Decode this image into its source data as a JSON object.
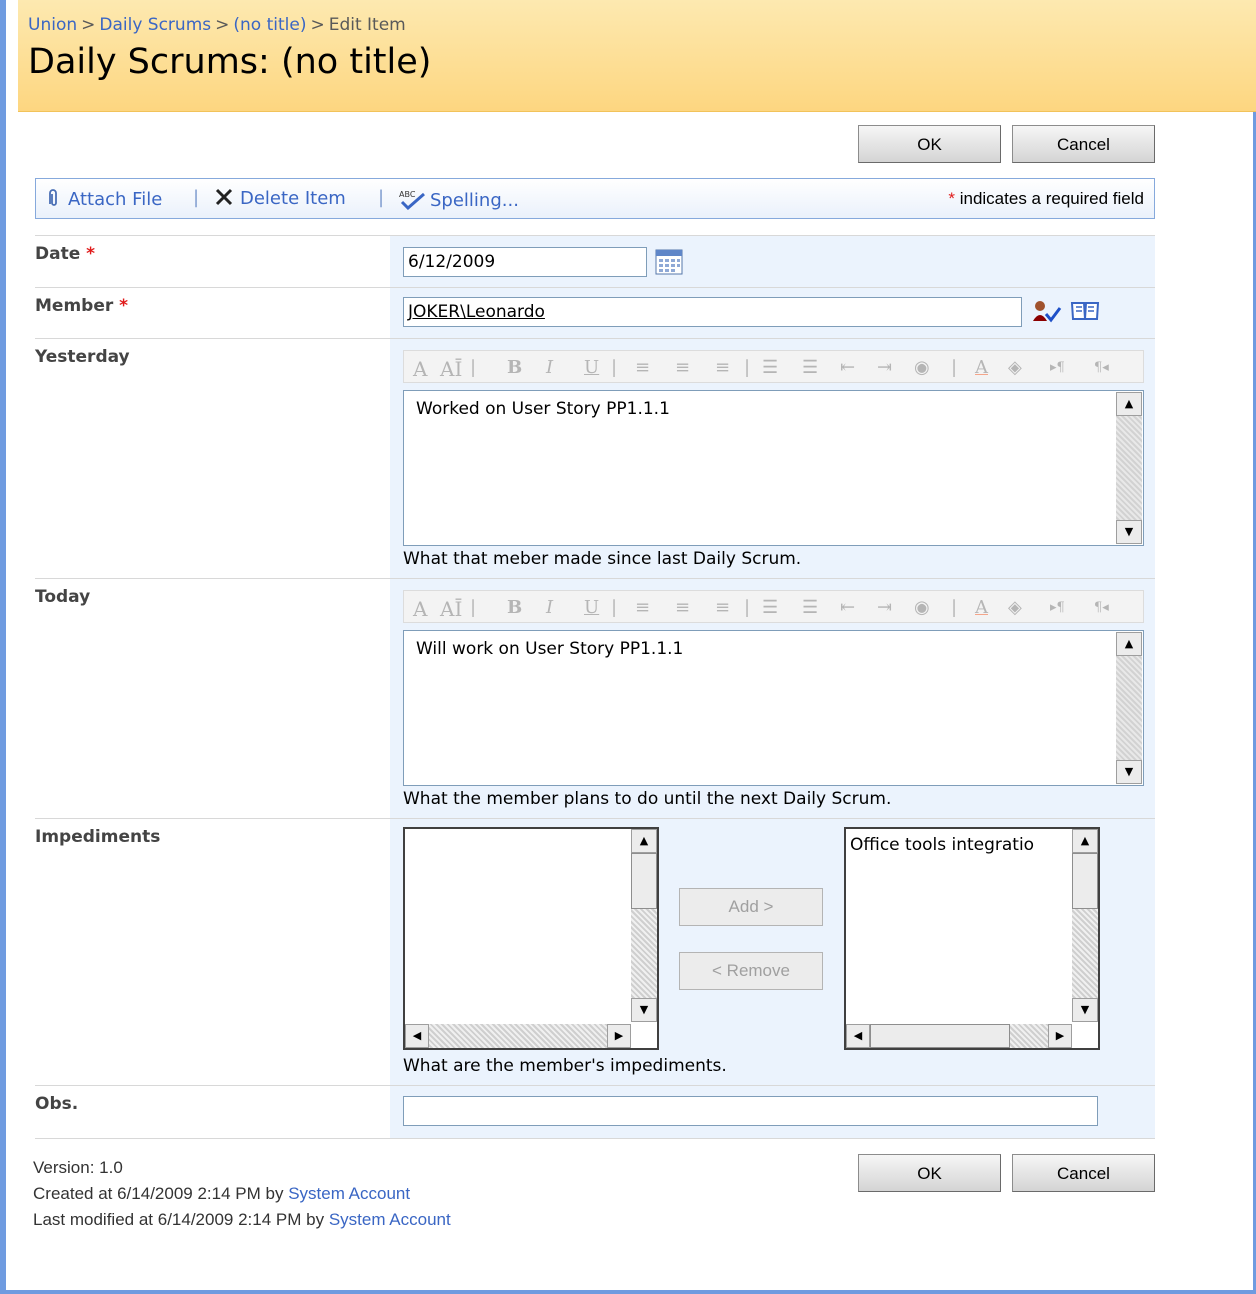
{
  "breadcrumb": {
    "items": [
      "Union",
      "Daily Scrums",
      "(no title)"
    ],
    "current": "Edit Item",
    "separator": ">"
  },
  "page_title": "Daily Scrums: (no title)",
  "buttons": {
    "ok": "OK",
    "cancel": "Cancel"
  },
  "toolbar": {
    "attach": "Attach File",
    "delete": "Delete Item",
    "spelling": "Spelling...",
    "required_note": "indicates a required field",
    "required_star": "*"
  },
  "fields": {
    "date": {
      "label": "Date",
      "value": "6/12/2009"
    },
    "member": {
      "label": "Member",
      "value": "JOKER\\Leonardo"
    },
    "yesterday": {
      "label": "Yesterday",
      "text": "Worked on User Story PP1.1.1",
      "hint": "What that meber made since last Daily Scrum."
    },
    "today": {
      "label": "Today",
      "text": "Will work on User Story PP1.1.1",
      "hint": "What the member plans to do until the next Daily Scrum."
    },
    "impediments": {
      "label": "Impediments",
      "available": [],
      "selected": [
        "Office tools integratio"
      ],
      "add_label": "Add >",
      "remove_label": "< Remove",
      "hint": "What are the member's impediments."
    },
    "obs": {
      "label": "Obs.",
      "value": ""
    }
  },
  "footer": {
    "version": "Version: 1.0",
    "created_prefix": "Created at 6/14/2009 2:14 PM  by",
    "created_by": "System Account",
    "modified_prefix": "Last modified at 6/14/2009 2:14 PM  by",
    "modified_by": "System Account"
  },
  "icons": {
    "attach": "paperclip-icon",
    "delete": "x-icon",
    "spelling": "spell-check-icon",
    "calendar": "calendar-icon",
    "check_names": "check-names-icon",
    "browse": "address-book-icon"
  },
  "colors": {
    "title_band": "#fdd680",
    "link": "#3a66c4",
    "field_bg": "#ebf3fd",
    "required": "#e01b1b"
  }
}
